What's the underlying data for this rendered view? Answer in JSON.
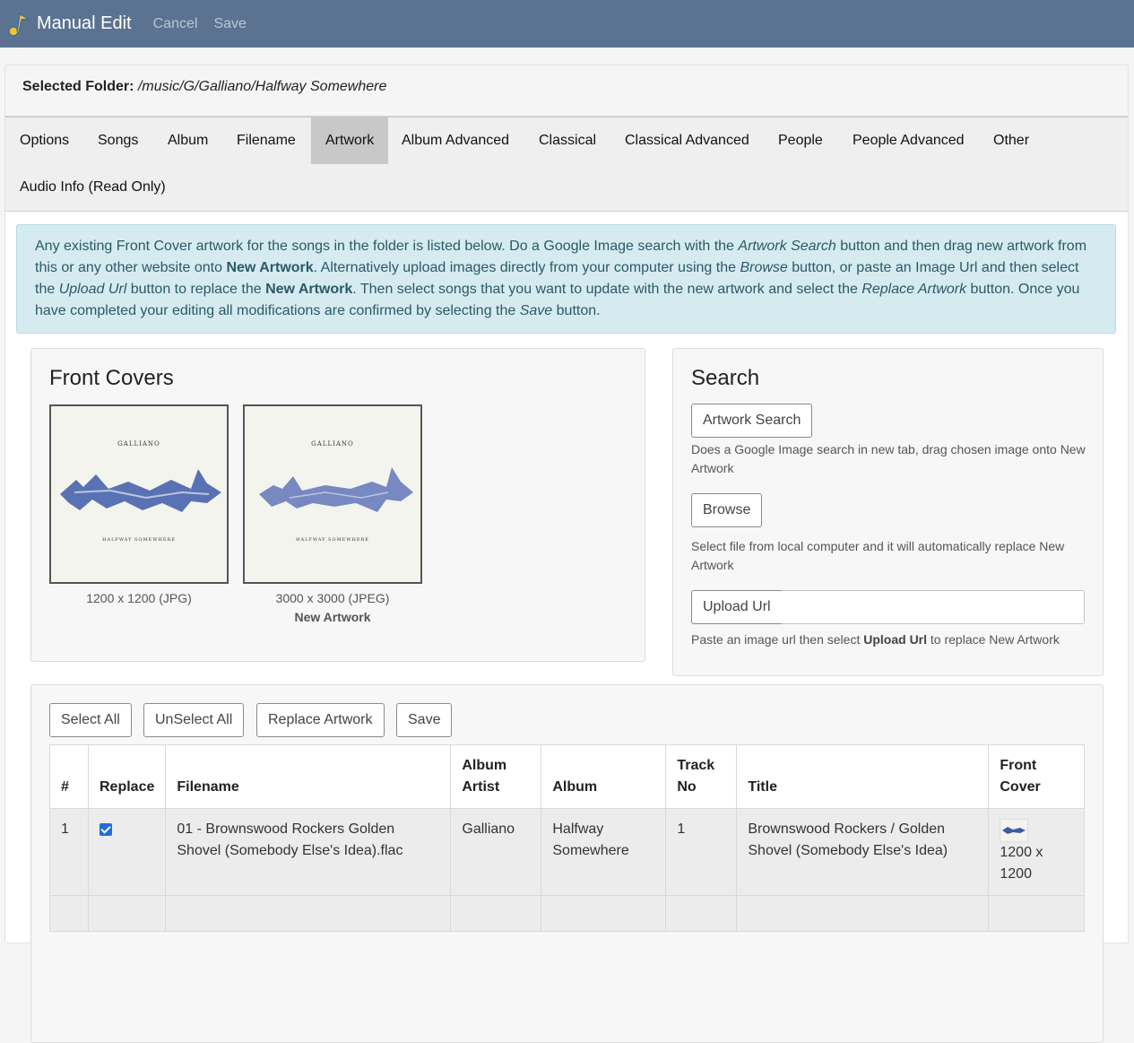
{
  "navbar": {
    "title": "Manual Edit",
    "cancel_label": "Cancel",
    "save_label": "Save",
    "icon": "music-note-icon"
  },
  "folder": {
    "label": "Selected Folder:",
    "path": "/music/G/Galliano/Halfway Somewhere"
  },
  "tabs": [
    {
      "label": "Options"
    },
    {
      "label": "Songs"
    },
    {
      "label": "Album"
    },
    {
      "label": "Filename"
    },
    {
      "label": "Artwork",
      "active": true
    },
    {
      "label": "Album Advanced"
    },
    {
      "label": "Classical"
    },
    {
      "label": "Classical Advanced"
    },
    {
      "label": "People"
    },
    {
      "label": "People Advanced"
    },
    {
      "label": "Other"
    },
    {
      "label": "Audio Info (Read Only)"
    }
  ],
  "alert": {
    "t1": "Any existing Front Cover artwork for the songs in the folder is listed below. Do a Google Image search with the ",
    "i1": "Artwork Search",
    "t2": " button and then drag new artwork from this or any other website onto ",
    "b1": "New Artwork",
    "t3": ". Alternatively upload images directly from your computer using the ",
    "i2": "Browse",
    "t4": " button, or paste an Image Url and then select the ",
    "i3": "Upload Url",
    "t5": " button to replace the ",
    "b2": "New Artwork",
    "t6": ". Then select songs that you want to update with the new artwork and select the ",
    "i4": "Replace Artwork",
    "t7": " button. Once you have completed your editing all modifications are confirmed by selecting the ",
    "i5": "Save",
    "t8": " button."
  },
  "front_covers": {
    "heading": "Front Covers",
    "covers": [
      {
        "art_top": "GALLIANO",
        "art_bottom": "HALFWAY SOMEWHERE",
        "caption": "1200 x 1200 (JPG)",
        "sub": ""
      },
      {
        "art_top": "GALLIANO",
        "art_bottom": "HALFWAY SOMEWHERE",
        "caption": "3000 x 3000 (JPEG)",
        "sub": "New Artwork"
      }
    ]
  },
  "search": {
    "heading": "Search",
    "artwork_search_label": "Artwork Search",
    "artwork_search_help": "Does a Google Image search in new tab, drag chosen image onto New Artwork",
    "browse_label": "Browse",
    "browse_help": "Select file from local computer and it will automatically replace New Artwork",
    "upload_url_label": "Upload Url",
    "upload_url_value": "",
    "upload_help_pre": "Paste an image url then select ",
    "upload_help_bold": "Upload Url",
    "upload_help_post": " to replace New Artwork"
  },
  "actions": {
    "select_all": "Select All",
    "unselect_all": "UnSelect All",
    "replace_artwork": "Replace Artwork",
    "save": "Save"
  },
  "table": {
    "headers": {
      "num": "#",
      "replace": "Replace",
      "filename": "Filename",
      "album_artist_1": "Album",
      "album_artist_2": "Artist",
      "album": "Album",
      "track_1": "Track",
      "track_2": "No",
      "title": "Title",
      "cover_1": "Front",
      "cover_2": "Cover"
    },
    "rows": [
      {
        "num": "1",
        "replace": true,
        "filename": "01 - Brownswood Rockers Golden Shovel (Somebody Else's Idea).flac",
        "album_artist": "Galliano",
        "album": "Halfway Somewhere",
        "track": "1",
        "title": "Brownswood Rockers / Golden Shovel (Somebody Else's Idea)",
        "cover_size": "1200 x 1200"
      }
    ]
  },
  "colors": {
    "navbar": "#5b7390",
    "alert_bg": "#d6ebf0",
    "alert_text": "#2a5a66",
    "active_tab": "#c8c8c8",
    "checkbox": "#1f6fd8"
  }
}
